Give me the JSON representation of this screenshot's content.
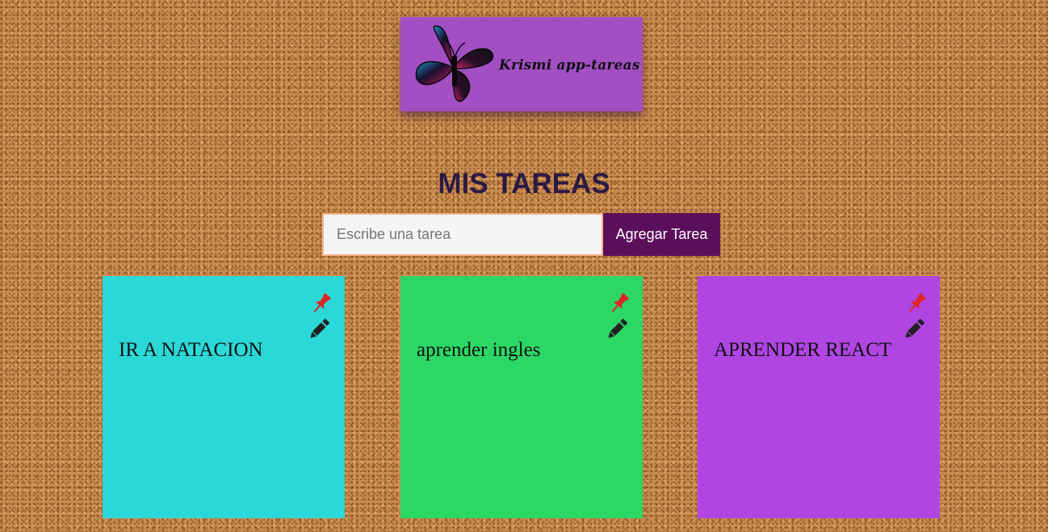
{
  "header": {
    "logo_text": "Krismi app-tareas",
    "logo_bg_color": "#a14fc3",
    "icon": "butterfly-icon"
  },
  "main": {
    "title": "MIS TAREAS",
    "input_placeholder": "Escribe una tarea",
    "input_value": "",
    "add_button_label": "Agregar Tarea",
    "add_button_color": "#5b0f5a"
  },
  "notes": [
    {
      "text": "IR A NATACION",
      "color": "#2bd8d8",
      "pin_icon": "pushpin-icon",
      "edit_icon": "pencil-icon"
    },
    {
      "text": "aprender ingles",
      "color": "#2bd866",
      "pin_icon": "pushpin-icon",
      "edit_icon": "pencil-icon"
    },
    {
      "text": "APRENDER REACT",
      "color": "#b145e3",
      "pin_icon": "pushpin-icon",
      "edit_icon": "pencil-icon"
    }
  ],
  "colors": {
    "title": "#2b1a45",
    "pin": "#e02424",
    "pencil": "#222222"
  }
}
